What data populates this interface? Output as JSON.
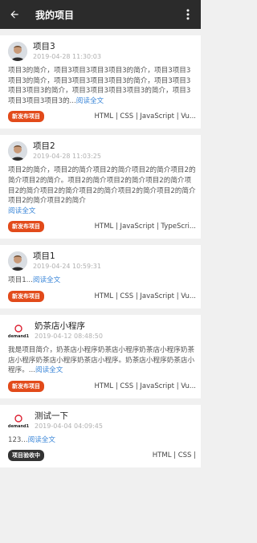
{
  "header": {
    "title": "我的项目"
  },
  "projects": [
    {
      "name": "项目3",
      "time": "2019-04-28 11:30:03",
      "desc": "项目3的简介，项目3项目3项目3项目3的简介，项目3项目3项目3的简介，项目3项目3项目3项目3的简介，项目3项目3项目3项目3的简介，项目3项目3项目3项目3的简介，项目3项目3项目3项目3的...",
      "more": "阅读全文",
      "status": "新发布项目",
      "tags": "HTML | CSS | JavaScript | Vu..."
    },
    {
      "name": "项目2",
      "time": "2019-04-28 11:03:25",
      "desc": "项目2的简介，项目2的简介项目2的简介项目2的简介项目2的简介项目2的简介。项目2的简介项目2的简介项目2的简介项目2的简介项目2的简介项目2的简介项目2的简介项目2的简介项目2的简介项目2的简介",
      "more": "阅读全文",
      "status": "新发布项目",
      "tags": "HTML | JavaScript | TypeScri..."
    },
    {
      "name": "项目1",
      "time": "2019-04-24 10:59:31",
      "desc": "项目1...",
      "more": "阅读全文",
      "status": "新发布项目",
      "tags": "HTML | CSS | JavaScript | Vu..."
    },
    {
      "name": "奶茶店小程序",
      "time": "2019-04-12 08:48:50",
      "desc": "我是项目简介，奶茶店小程序奶茶店小程序奶茶店小程序奶茶店小程序奶茶店小程序奶茶店小程序。奶茶店小程序奶茶店小程序。...",
      "more": "阅读全文",
      "status": "新发布项目",
      "tags": "HTML | CSS | JavaScript | Vu...",
      "logo": "demand1"
    },
    {
      "name": "测试一下",
      "time": "2019-04-04 04:09:45",
      "desc": "123...",
      "more": "阅读全文",
      "status": "项目验收中",
      "tags": "HTML | CSS |",
      "logo": "demand1"
    }
  ]
}
